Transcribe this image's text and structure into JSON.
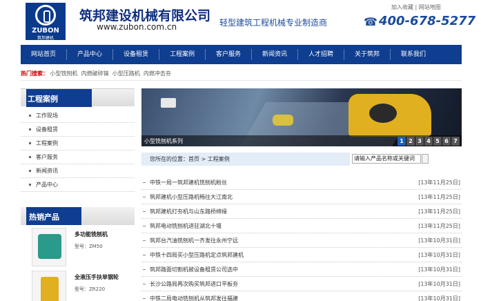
{
  "header": {
    "logo_en": "ZUBON",
    "logo_cn": "筑邦建机",
    "company_name": "筑邦建设机械有限公司",
    "company_url": "www.zubon.com.cn",
    "slogan": "轻型建筑工程机械专业制造商",
    "top_links": [
      "加入收藏",
      "网站地图"
    ],
    "phone": "400-678-5277",
    "phone_icon": "phone-icon"
  },
  "nav": {
    "items": [
      "网站首页",
      "产品中心",
      "设备租赁",
      "工程案例",
      "客户服务",
      "新闻资讯",
      "人才招聘",
      "关于筑邦",
      "联系我们"
    ]
  },
  "hot_search": {
    "label": "热门搜索：",
    "terms": [
      "小型铣刨机",
      "内燃破碎镐",
      "小型压路机",
      "内燃冲击夯"
    ]
  },
  "sidebar": {
    "title_bold": "工程",
    "title_rest": "案例",
    "items": [
      "工作现场",
      "设备租赁",
      "工程案例",
      "客户服务",
      "新闻资讯",
      "产品中心"
    ]
  },
  "hot_products": {
    "title_bold": "热销",
    "title_rest": "产品",
    "items": [
      {
        "name": "多功能铣刨机",
        "model": "型号：ZM50"
      },
      {
        "name": "全液压手扶单钢轮",
        "model": "型号：ZR220"
      }
    ]
  },
  "banner": {
    "caption": "小型铣刨机系列",
    "pages": [
      "1",
      "2",
      "3",
      "4",
      "5",
      "6",
      "7"
    ],
    "active_page": "1"
  },
  "breadcrumb": {
    "text": "您所在的位置：首页 > 工程案例"
  },
  "search": {
    "placeholder": "请输入产品名称或关键词"
  },
  "news": [
    {
      "title": "中铁一局一筑邦建机铣刨机粉丝",
      "date": "[13年11月25日]"
    },
    {
      "title": "筑邦建机小型压路机畅往大江南北",
      "date": "[13年11月25日]"
    },
    {
      "title": "筑邦建机打夯机与山东路桥缔缘",
      "date": "[13年11月25日]"
    },
    {
      "title": "筑邦电动铣刨机进驻湖北十堰",
      "date": "[13年11月25日]"
    },
    {
      "title": "筑邦台汽油铣刨机一齐发往永州宁远",
      "date": "[13年10月31日]"
    },
    {
      "title": "中铁十四局买小型压路机定点筑邦建机",
      "date": "[13年10月31日]"
    },
    {
      "title": "筑邦路面切割机被设备租赁公司选中",
      "date": "[13年10月31日]"
    },
    {
      "title": "长沙公路局再次购买筑邦进口平板夯",
      "date": "[13年10月31日]"
    },
    {
      "title": "中铁二局电动铣刨机从筑邦发往福建",
      "date": "[13年10月31日]"
    }
  ]
}
